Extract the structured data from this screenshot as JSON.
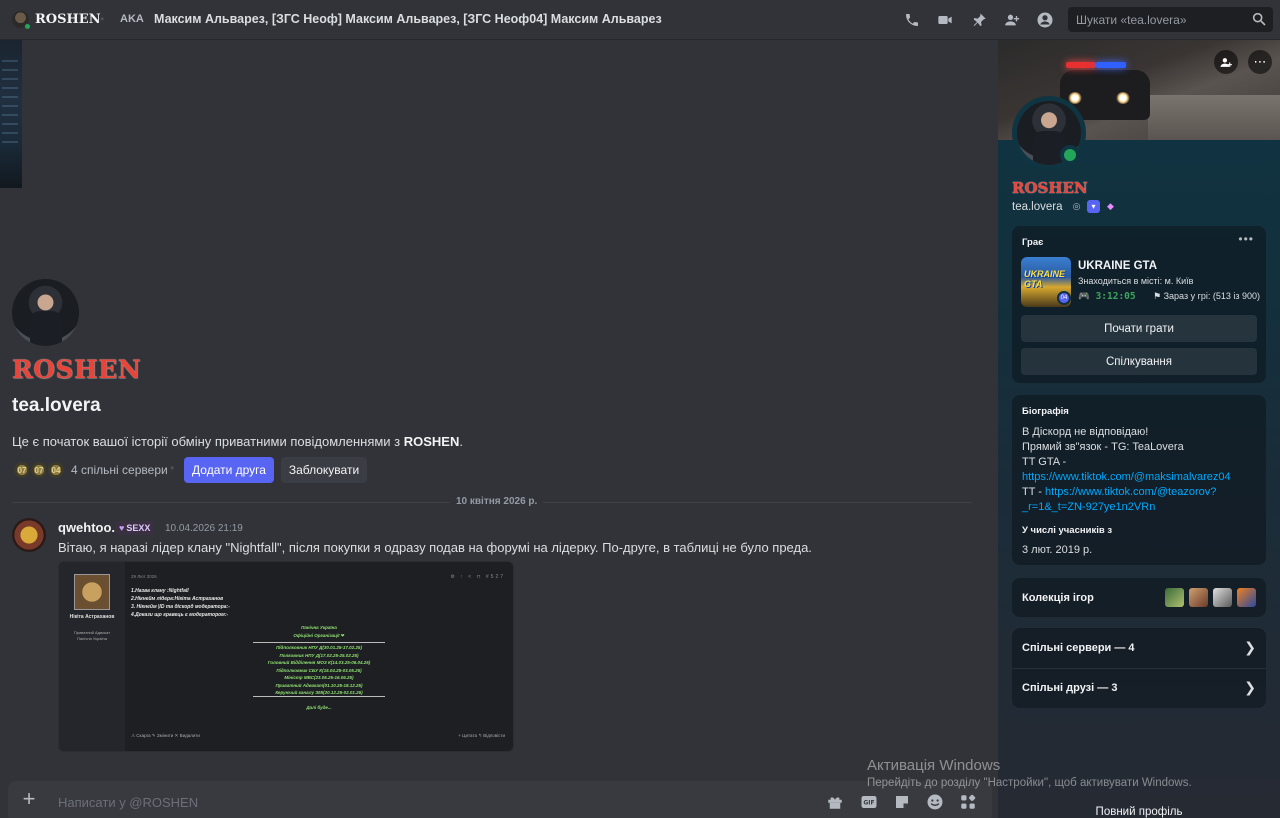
{
  "header": {
    "title": "ROSHEN",
    "aka_label": "AKA",
    "aka_names": "Максим Альварез, [ЗГС Неоф] Максим Альварез, [ЗГС Неоф04] Максим Альварез",
    "search_placeholder": "Шукати «tea.lovera»"
  },
  "intro": {
    "display_name": "ROSHEN",
    "username": "tea.lovera",
    "text_prefix": "Це є початок вашої історії обміну приватними повідомленнями з ",
    "text_name": "ROSHEN",
    "text_suffix": ".",
    "server_icons": [
      "07",
      "07",
      "04"
    ],
    "mutual_servers": "4 спільні сервери",
    "add_friend": "Додати друга",
    "block": "Заблокувати"
  },
  "divider_date": "10 квітня 2026 р.",
  "message": {
    "author": "qwehtoo.",
    "tag": "SEXX",
    "timestamp": "10.04.2026 21:19",
    "text": "Вітаю, я наразі лідер клану \"Nightfall\", після покупки я одразу подав на форумі на лідерку. По-друге, в таблиці не було преда."
  },
  "attachment": {
    "name": "Нікіта Астраханов",
    "role_1": "Приватний Адвокат",
    "role_2": "Панічна Україна",
    "date": "29 Лют 2026",
    "icons": "⚙ ↑ < ⊓ #527",
    "list": [
      "1.Назва клану :Nightfall",
      "2.Нікнейм лідера:Нікіта Астраханов",
      "3. Нікнейм |ID та діскорд модераторa:-",
      "4.Докази що гравець є модератором:-"
    ],
    "center": [
      "Панічна Україна",
      "Офіційні Організації ❤",
      "Підполковник НПУ Д(30.01.25-17.02.25)",
      "Полковник НПУ Д(17.02.25-25.02.25)",
      "Головний Відділення МОЗ К(14.03.25-06.04.25)",
      "Підполковник СБУ К(15.04.25-03.05.25)",
      "Міністр МВС(23.05.25-16.06.25)",
      "Приватний Адвокат(01.10.25-18.12.25)",
      "Керуючий каналу ЗМІ(20.12.25-02.01.26)",
      "Далі буде..."
    ],
    "footer_left": "⚠ Скарга   ✎ Змінити   ✕ Видалити",
    "footer_right": "+ Цитата   ↰ Відповісти"
  },
  "input": {
    "placeholder": "Написати у @ROSHEN"
  },
  "panel": {
    "display_name": "ROSHEN",
    "username": "tea.lovera",
    "activity_label": "Грає",
    "game_title": "UKRAINE GTA",
    "game_art_text": "UKRAINE GTA",
    "game_badge": "04",
    "game_location": "Знаходиться в місті: м. Київ",
    "game_time": "3:12:05",
    "game_players": "Зараз у грі: (513 із 900)",
    "play_button": "Почати грати",
    "chat_button": "Спілкування",
    "bio_label": "Біографія",
    "bio_lines": [
      "В Діскорд не відповідаю!",
      "Прямий зв\"язок - TG: TeaLovera",
      "TT GTA -"
    ],
    "bio_link1": "https://www.tiktok.com/@maksimalvarez04",
    "bio_tt": "TT - ",
    "bio_link2a": "https://www.tiktok.com/@teazorov?",
    "bio_link2b": "_r=1&_t=ZN-927ye1n2VRn",
    "member_since_label": "У числі учасників з",
    "member_since": "3 лют. 2019 р.",
    "games_collection": "Колекція ігор",
    "mutual_servers": "Спільні сервери — 4",
    "mutual_friends": "Спільні друзі — 3",
    "full_profile": "Повний профіль"
  },
  "watermark": {
    "line1": "Активація Windows",
    "line2": "Перейдіть до розділу \"Настройки\", щоб активувати Windows."
  },
  "colors": {
    "accent": "#5865f2",
    "online": "#23a55a",
    "name_red": "#e8443a",
    "link": "#00a8fc"
  }
}
